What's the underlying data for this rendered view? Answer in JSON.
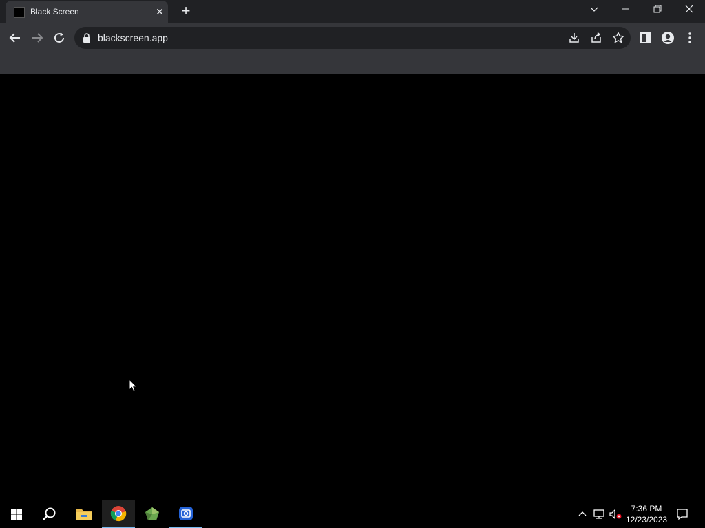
{
  "tab": {
    "title": "Black Screen",
    "favicon_color": "#000000"
  },
  "omnibox": {
    "url": "blackscreen.app"
  },
  "taskbar": {
    "time": "7:36 PM",
    "date": "12/23/2023",
    "apps": [
      "start-icon",
      "search-icon",
      "file-explorer-icon",
      "chrome-icon",
      "app-green-icon",
      "app-blue-icon"
    ]
  },
  "colors": {
    "frame": "#202124",
    "toolbar": "#35363a",
    "accent": "#76b9ed"
  }
}
